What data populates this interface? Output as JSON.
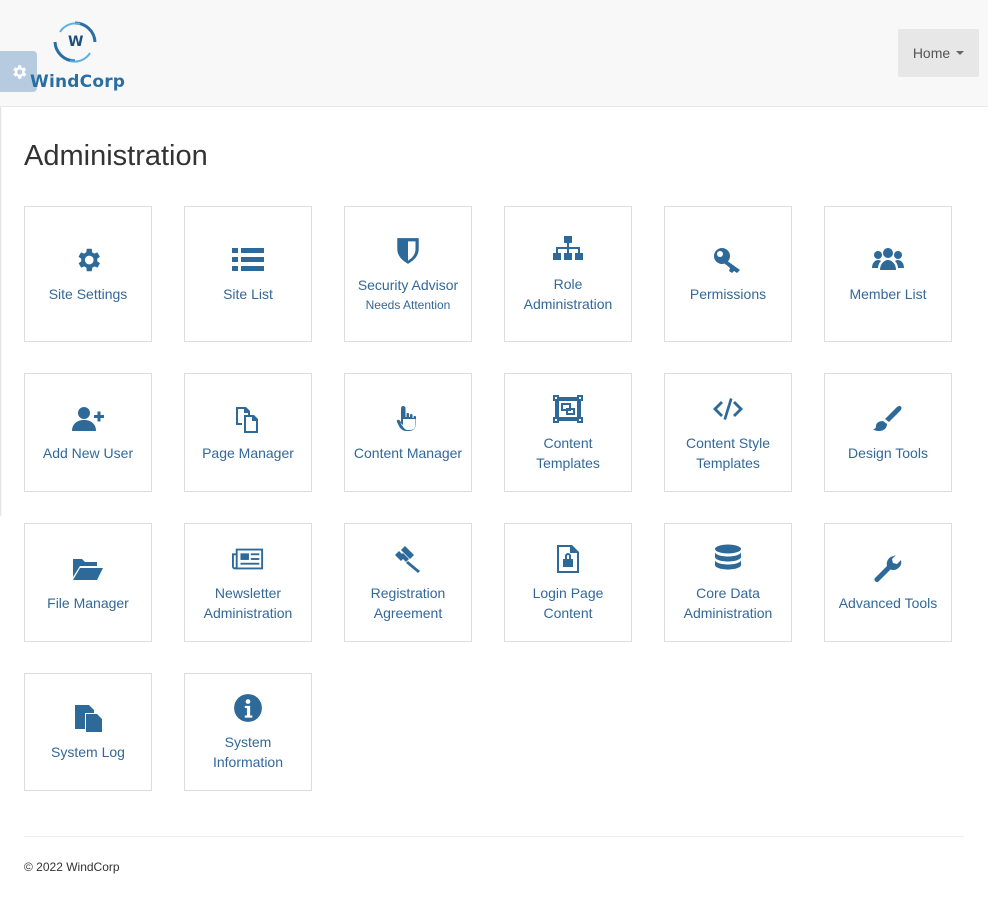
{
  "brand": {
    "logo_letter": "W",
    "name": "WindCorp"
  },
  "nav": {
    "home_label": "Home"
  },
  "page": {
    "title": "Administration"
  },
  "tiles": [
    {
      "label": "Site Settings",
      "icon": "gear-icon"
    },
    {
      "label": "Site List",
      "icon": "list-icon"
    },
    {
      "label": "Security Advisor",
      "sub": "Needs Attention",
      "icon": "shield-icon"
    },
    {
      "label": "Role Administration",
      "icon": "sitemap-icon"
    },
    {
      "label": "Permissions",
      "icon": "key-icon"
    },
    {
      "label": "Member List",
      "icon": "users-icon"
    },
    {
      "label": "Add New User",
      "icon": "user-plus-icon"
    },
    {
      "label": "Page Manager",
      "icon": "pages-icon"
    },
    {
      "label": "Content Manager",
      "icon": "hand-pointer-icon"
    },
    {
      "label": "Content Templates",
      "icon": "object-group-icon"
    },
    {
      "label": "Content Style Templates",
      "icon": "code-icon"
    },
    {
      "label": "Design Tools",
      "icon": "paint-brush-icon"
    },
    {
      "label": "File Manager",
      "icon": "folder-open-icon"
    },
    {
      "label": "Newsletter Administration",
      "icon": "newspaper-icon"
    },
    {
      "label": "Registration Agreement",
      "icon": "gavel-icon"
    },
    {
      "label": "Login Page Content",
      "icon": "file-lock-icon"
    },
    {
      "label": "Core Data Administration",
      "icon": "database-icon"
    },
    {
      "label": "Advanced Tools",
      "icon": "wrench-icon"
    },
    {
      "label": "System Log",
      "icon": "copy-icon"
    },
    {
      "label": "System Information",
      "icon": "info-circle-icon"
    }
  ],
  "footer": {
    "text": "© 2022 WindCorp"
  },
  "colors": {
    "accent": "#2d6a9a",
    "link": "#336899",
    "topbar": "#f8f8f8"
  }
}
